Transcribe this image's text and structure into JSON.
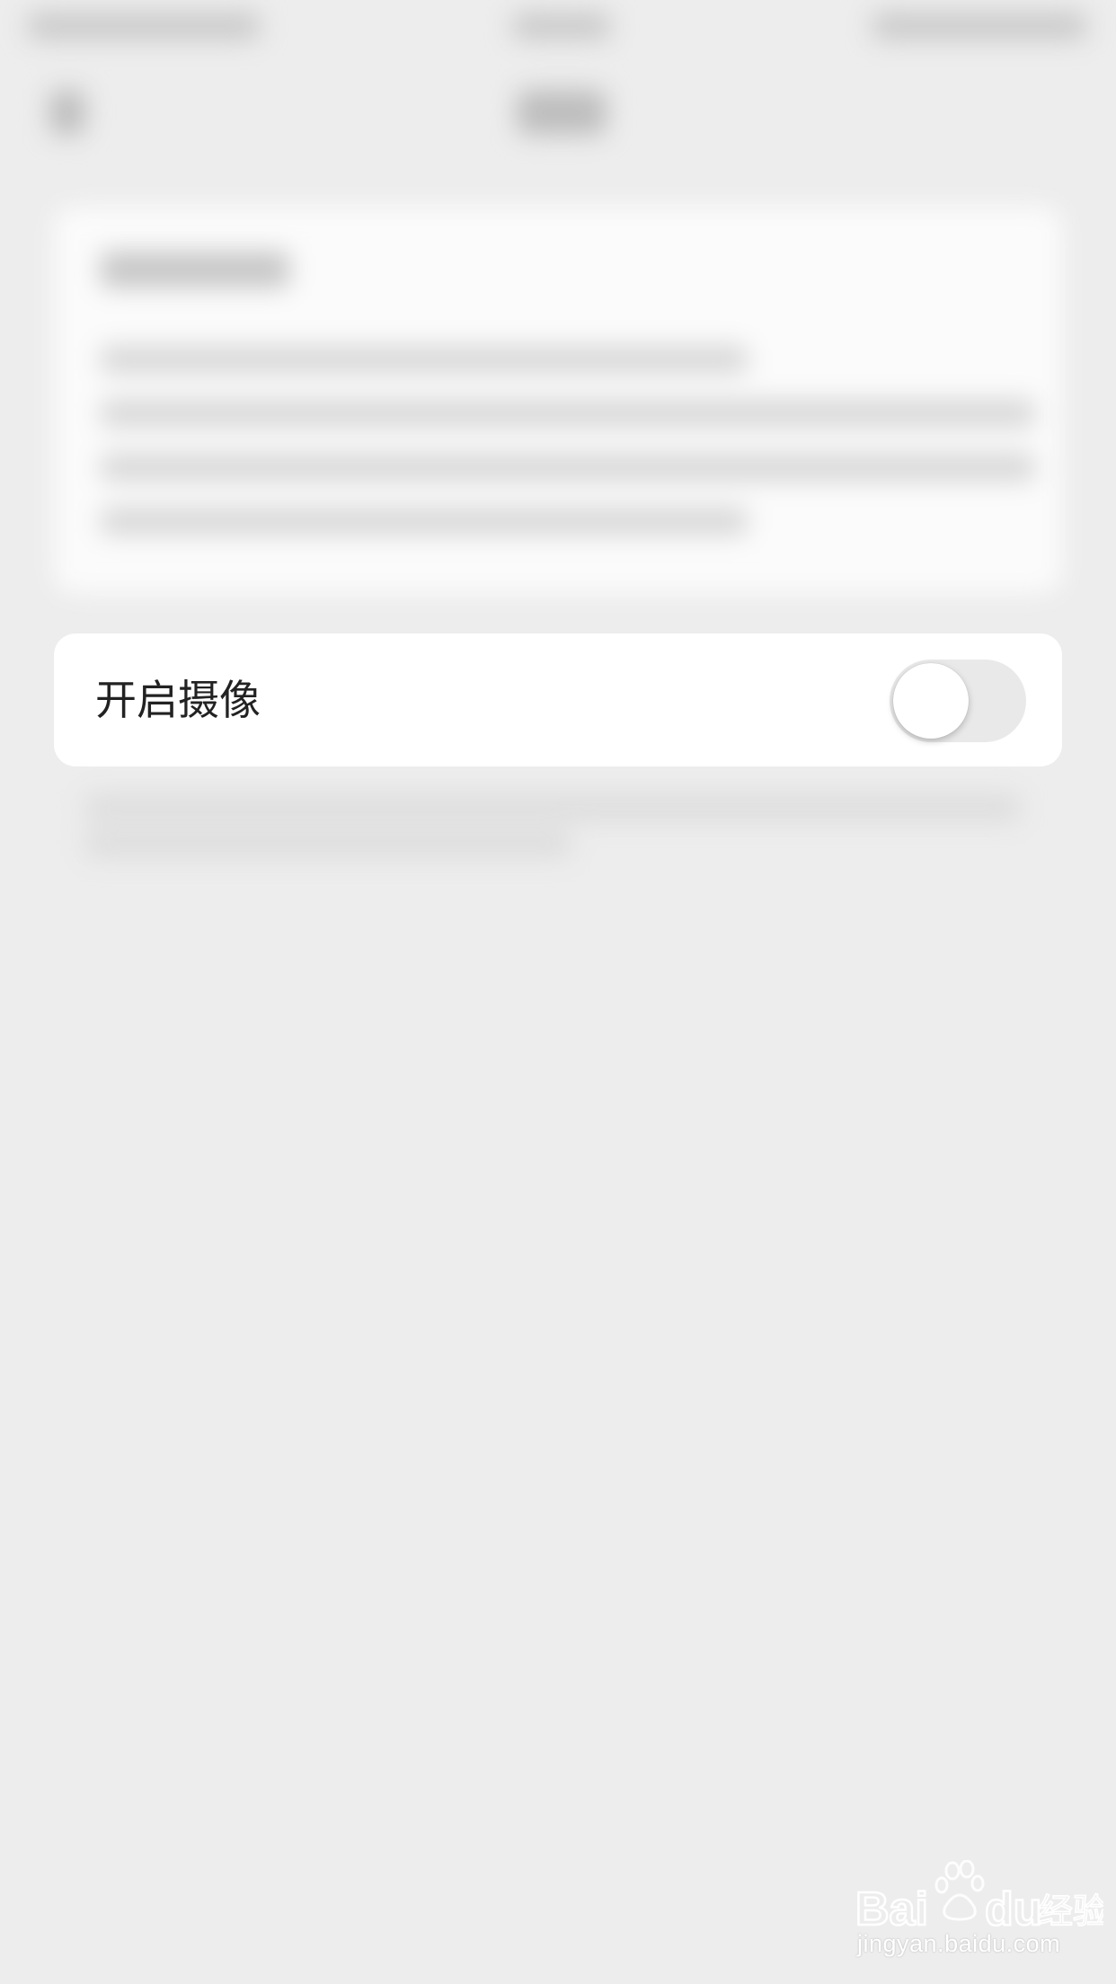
{
  "setting": {
    "label": "开启摄像",
    "toggle_on": false
  },
  "colors": {
    "background": "#ededed",
    "card": "#ffffff",
    "toggle_track_off": "#e9e9e9",
    "label_text": "#222222"
  },
  "watermark": {
    "logo_text": "Bai du 经验",
    "url": "jingyan.baidu.com"
  }
}
